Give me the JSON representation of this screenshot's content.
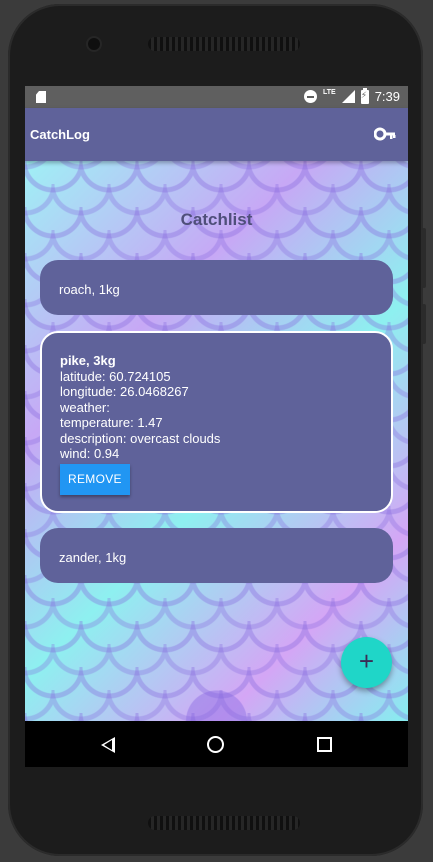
{
  "status_bar": {
    "time": "7:39",
    "network_label": "LTE",
    "icons": [
      "sd-card-icon",
      "do-not-disturb-icon",
      "signal-icon",
      "battery-charging-icon"
    ]
  },
  "app_bar": {
    "title": "CatchLog",
    "action_icon": "key-icon"
  },
  "main": {
    "title": "Catchlist",
    "catches": [
      {
        "label": "roach, 1kg",
        "expanded": false
      },
      {
        "label": "pike, 3kg",
        "expanded": true,
        "details": {
          "latitude": "latitude: 60.724105",
          "longitude": "longitude: 26.0468267",
          "weather": "weather:",
          "temperature": "temperature: 1.47",
          "description": "description: overcast clouds",
          "wind": "wind: 0.94"
        },
        "remove_label": "REMOVE"
      },
      {
        "label": "zander, 1kg",
        "expanded": false
      }
    ]
  },
  "fab": {
    "label": "+",
    "icon": "plus-icon"
  },
  "nav_bar": {
    "icons": [
      "back-icon",
      "home-icon",
      "recents-icon"
    ]
  },
  "colors": {
    "primary": "#5f629a",
    "accent": "#1fd6c8",
    "button": "#2196f3"
  }
}
